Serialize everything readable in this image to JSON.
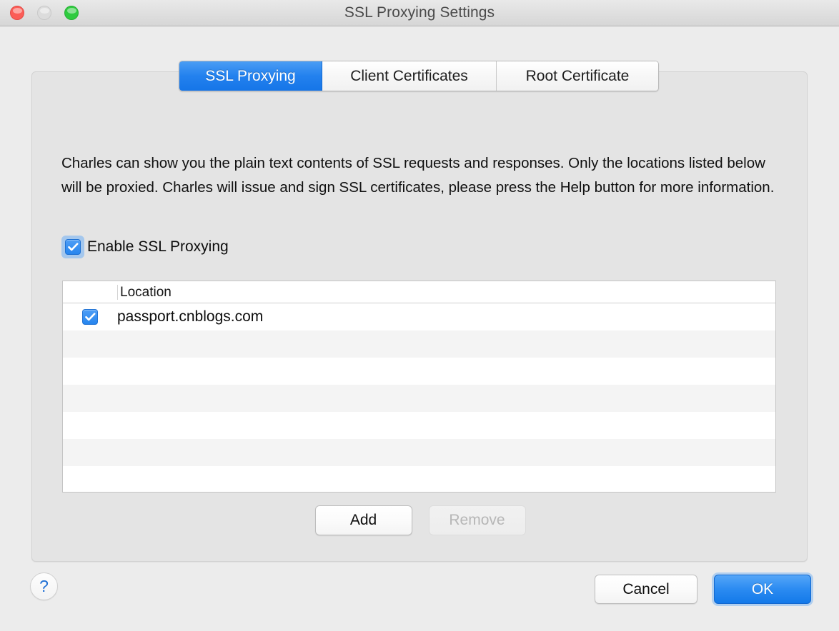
{
  "window": {
    "title": "SSL Proxying Settings",
    "traffic_lights": [
      {
        "name": "close",
        "color": "#fb5d57"
      },
      {
        "name": "minimize",
        "color": "#dcdcdc"
      },
      {
        "name": "maximize",
        "color": "#2fcb3f"
      }
    ]
  },
  "tabs": [
    {
      "label": "SSL Proxying",
      "active": true
    },
    {
      "label": "Client Certificates",
      "active": false
    },
    {
      "label": "Root Certificate",
      "active": false
    }
  ],
  "main": {
    "description": "Charles can show you the plain text contents of SSL requests and responses. Only the locations listed below will be proxied. Charles will issue and sign SSL certificates, please press the Help button for more information.",
    "enable_checkbox": {
      "label": "Enable SSL Proxying",
      "checked": true,
      "focused": true
    },
    "table": {
      "columns": [
        "",
        "Location"
      ],
      "rows": [
        {
          "checked": true,
          "location": "passport.cnblogs.com"
        },
        {
          "checked": null,
          "location": ""
        },
        {
          "checked": null,
          "location": ""
        },
        {
          "checked": null,
          "location": ""
        },
        {
          "checked": null,
          "location": ""
        },
        {
          "checked": null,
          "location": ""
        },
        {
          "checked": null,
          "location": ""
        }
      ]
    },
    "list_buttons": {
      "add_label": "Add",
      "add_enabled": true,
      "remove_label": "Remove",
      "remove_enabled": false
    }
  },
  "footer": {
    "help_label": "?",
    "cancel_label": "Cancel",
    "ok_label": "OK",
    "ok_is_default": true
  },
  "colors": {
    "accent_blue": "#2381ee",
    "window_bg": "#ececec",
    "panel_bg": "#e4e4e4",
    "row_stripe": "#f4f4f4",
    "help_glyph": "#1f6fd4"
  }
}
